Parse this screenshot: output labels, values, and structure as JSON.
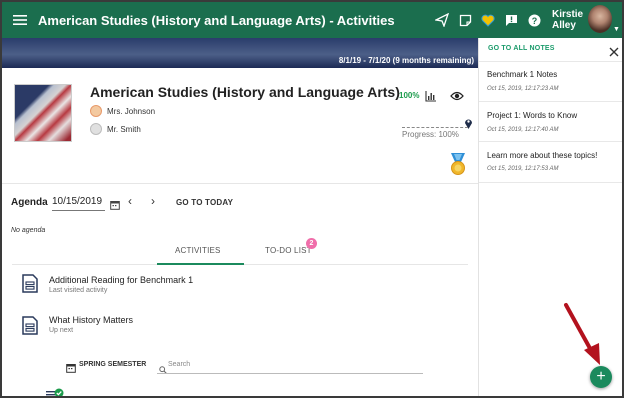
{
  "topbar": {
    "title": "American Studies (History and Language Arts) - Activities",
    "user_first": "Kirstie",
    "user_last": "Alley",
    "icons": [
      "menu-icon",
      "send-icon",
      "notes-icon",
      "heart-icon",
      "feedback-icon",
      "help-icon"
    ]
  },
  "banner": {
    "date_range": "8/1/19 - 7/1/20 (9 months remaining)"
  },
  "course": {
    "title": "American Studies (History and Language Arts)",
    "teachers": [
      "Mrs. Johnson",
      "Mr. Smith"
    ],
    "percent": "100%",
    "progress_label": "Progress: 100%"
  },
  "agenda": {
    "label": "Agenda",
    "date": "10/15/2019",
    "goto_today": "GO TO TODAY",
    "no_agenda": "No agenda"
  },
  "tabs": {
    "activities": "ACTIVITIES",
    "todo": "TO-DO LIST",
    "todo_count": "2"
  },
  "activities": [
    {
      "title": "Additional Reading for Benchmark 1",
      "subtitle": "Last visited activity"
    },
    {
      "title": "What History Matters",
      "subtitle": "Up next"
    }
  ],
  "semester": {
    "label": "SPRING SEMESTER",
    "search_placeholder": "Search"
  },
  "notes_panel": {
    "goto_all": "GO TO ALL NOTES",
    "notes": [
      {
        "title": "Benchmark 1 Notes",
        "date": "Oct 15, 2019, 12:17:23 AM"
      },
      {
        "title": "Project 1: Words to Know",
        "date": "Oct 15, 2019, 12:17:40 AM"
      },
      {
        "title": "Learn more about these topics!",
        "date": "Oct 15, 2019, 12:17:53 AM"
      }
    ]
  },
  "fab": {
    "label": "+"
  },
  "colors": {
    "primary": "#1b6e4e",
    "accent": "#1b9b6b",
    "badge": "#f06eaa",
    "arrow": "#b3121e"
  }
}
